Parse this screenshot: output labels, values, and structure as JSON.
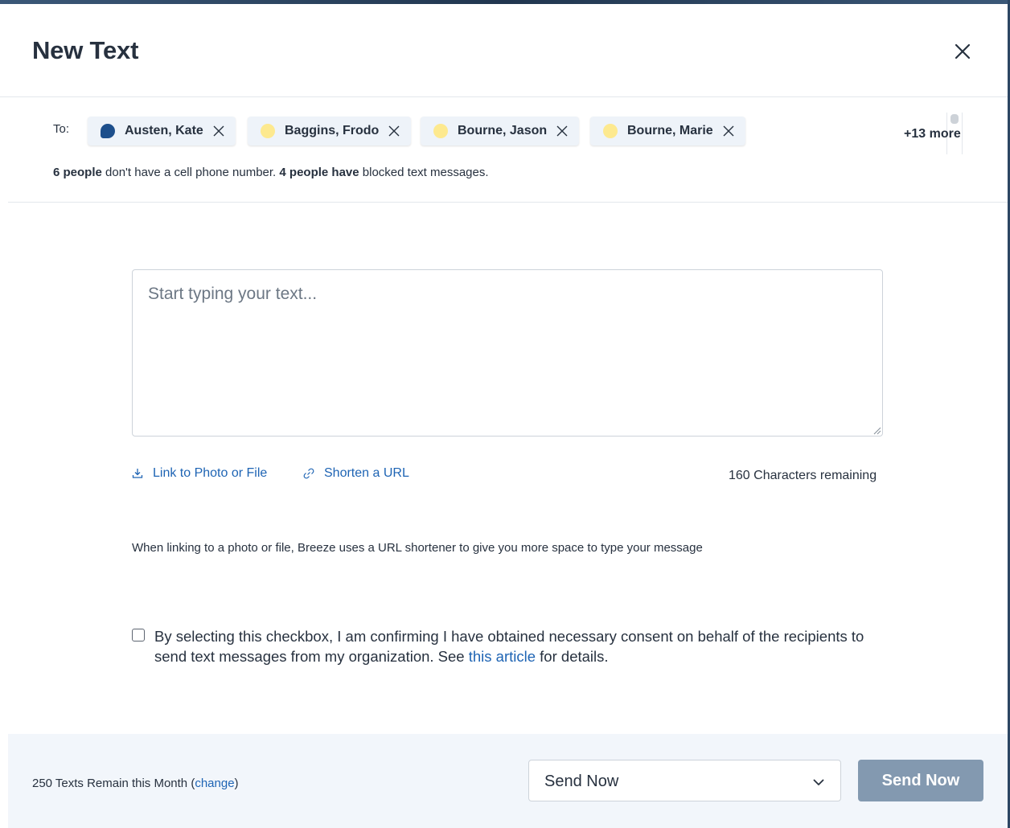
{
  "header": {
    "title": "New Text",
    "close_icon": "close-icon"
  },
  "recipients": {
    "to_label": "To:",
    "chips": [
      {
        "name": "Austen, Kate",
        "status_color": "#1d4f8c",
        "icon": "chat-bubble-icon"
      },
      {
        "name": "Baggins, Frodo",
        "status_color": "#fde98f",
        "icon": "status-dot-icon"
      },
      {
        "name": "Bourne, Jason",
        "status_color": "#fde98f",
        "icon": "status-dot-icon"
      },
      {
        "name": "Bourne, Marie",
        "status_color": "#fde98f",
        "icon": "status-dot-icon"
      }
    ],
    "more_label": "+13 more",
    "warning": {
      "no_phone_count": "6 people",
      "no_phone_text": " don't have a cell phone number. ",
      "blocked_count": "4 people have",
      "blocked_text": " blocked text messages."
    }
  },
  "composer": {
    "placeholder": "Start typing your text...",
    "value": "",
    "link_photo_label": "Link to Photo or File",
    "shorten_url_label": "Shorten a URL",
    "chars_remaining": "160 Characters remaining",
    "note": "When linking to a photo or file, Breeze uses a URL shortener to give you more space to type your message"
  },
  "consent": {
    "checked": false,
    "text_before": "By selecting this checkbox, I am confirming I have obtained necessary consent on behalf of the recipients to send text messages from my organization. See ",
    "link_text": "this article",
    "text_after": " for details."
  },
  "footer": {
    "remain_text": "250 Texts Remain this Month (",
    "change_link": "change",
    "remain_close": ")",
    "schedule_selected": "Send Now",
    "send_button": "Send Now"
  },
  "colors": {
    "accent_link": "#1e64b4",
    "send_button_bg": "#8399b0",
    "footer_bg": "#f2f6fb",
    "chip_bg": "#eef3f9"
  }
}
